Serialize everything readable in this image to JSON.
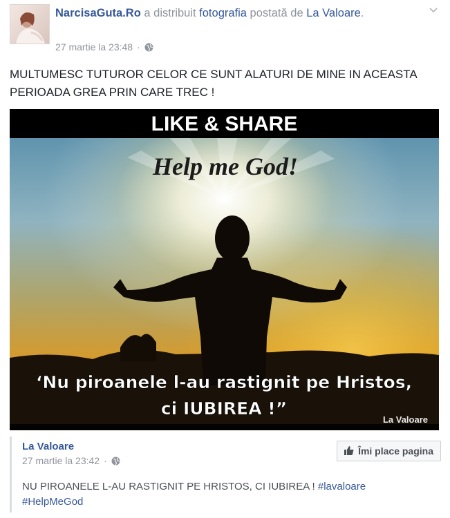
{
  "post": {
    "author": "NarcisaGuta.Ro",
    "action": " a distribuit ",
    "object": "fotografia",
    "posted_by_text": " postată de ",
    "original_page": "La Valoare",
    "period": ".",
    "timestamp": "27 martie la 23:48",
    "separator": "·",
    "text": "MULTUMESC TUTUROR CELOR CE SUNT ALATURI DE MINE IN ACEASTA PERIOADA GREA PRIN CARE TREC !"
  },
  "image": {
    "top_banner": "LIKE & SHARE",
    "headline": "Help me God!",
    "quote_line1": "‘Nu piroanele l-au rastignit pe Hristos,",
    "quote_line2": "ci IUBIREA !”",
    "watermark": "La Valoare"
  },
  "embed": {
    "page_name": "La Valoare",
    "timestamp": "27 martie la 23:42",
    "separator": "·",
    "like_button": "Îmi place pagina",
    "text": "NU PIROANELE L-AU RASTIGNIT PE HRISTOS, CI IUBIREA ! ",
    "hashtag1": "#lavaloare",
    "hashtag2": "#HelpMeGod"
  },
  "icons": {
    "chevron": "chevron-down-icon",
    "globe": "globe-icon",
    "like": "thumbs-up-icon"
  }
}
